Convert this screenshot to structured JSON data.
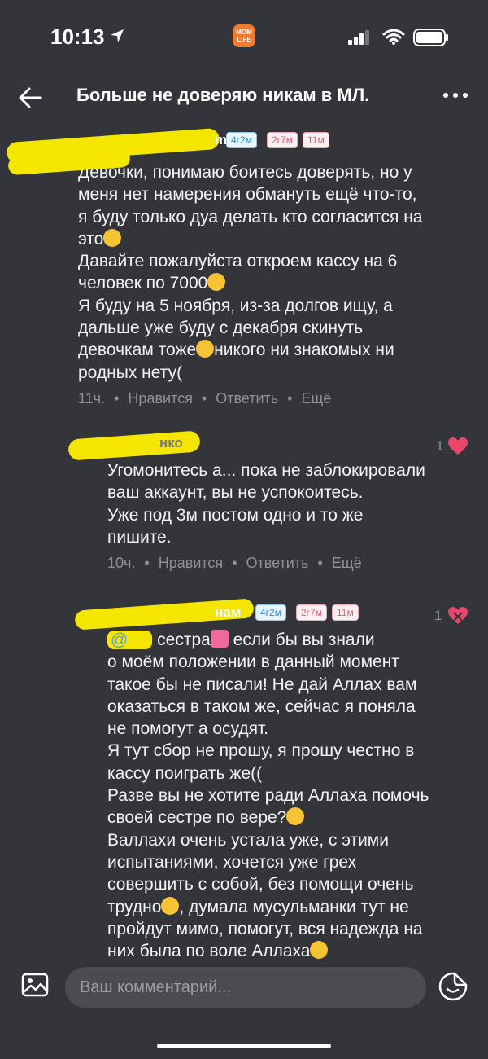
{
  "status_bar": {
    "time": "10:13",
    "app_badge": "MOM LIFE"
  },
  "header": {
    "title": "Больше не доверяю никам в МЛ."
  },
  "comments": [
    {
      "username": "m",
      "tags": [
        "4г2м",
        "2г7м",
        "11м"
      ],
      "text_lines": [
        "Девочки, понимаю боитесь доверять, но у",
        "меня нет намерения обмануть ещё что-то,",
        "я буду только дуа делать кто согласится на",
        "это",
        "Давайте пожалуйста откроем кассу на 6",
        "человек по 7000",
        "Я буду на 5 ноября, из-за долгов ищу, а",
        "дальше уже буду с декабря скинуть",
        "девочкам тоже",
        "никого ни знакомых ни",
        "родных нету("
      ],
      "time": "11ч.",
      "like_label": "Нравится",
      "reply_label": "Ответить",
      "more_label": "Ещё"
    },
    {
      "username": "нко",
      "likes": "1",
      "text_lines": [
        "Угомонитесь а... пока не заблокировали",
        "ваш аккаунт, вы не успокоитесь.",
        "Уже под 3м постом одно и то же",
        "пишите."
      ],
      "time": "10ч.",
      "like_label": "Нравится",
      "reply_label": "Ответить",
      "more_label": "Ещё"
    },
    {
      "username": "нам",
      "tags": [
        "4г2м",
        "2г7м",
        "11м"
      ],
      "likes": "1",
      "mention": "@",
      "text_lines": [
        "сестра",
        "если бы вы знали",
        "о моём положении в данный момент",
        "такое бы не писали! Не дай Аллах вам",
        "оказаться в таком же, сейчас я поняла",
        "не помогут а осудят.",
        "Я тут сбор не прошу, я прошу честно в",
        "кассу поиграть же((",
        "Разве вы не хотите ради Аллаха помочь",
        "своей сестре по вере?",
        "Валлахи очень устала уже, с этими",
        "испытаниями, хочется уже грех",
        "совершить с собой, без помощи очень",
        "трудно",
        ", думала мусульманки тут не",
        "пройдут мимо, помогут, вся надежда на",
        "них была по воле Аллаха"
      ]
    }
  ],
  "input": {
    "placeholder": "Ваш комментарий..."
  },
  "colors": {
    "background": "#33353a",
    "heart": "#e8466a",
    "highlight": "#f5e600",
    "link": "#5aa2e6"
  },
  "icons": [
    "back-icon",
    "more-icon",
    "heart-icon",
    "image-icon",
    "sticker-icon",
    "location-icon",
    "signal-icon",
    "wifi-icon",
    "battery-icon"
  ]
}
